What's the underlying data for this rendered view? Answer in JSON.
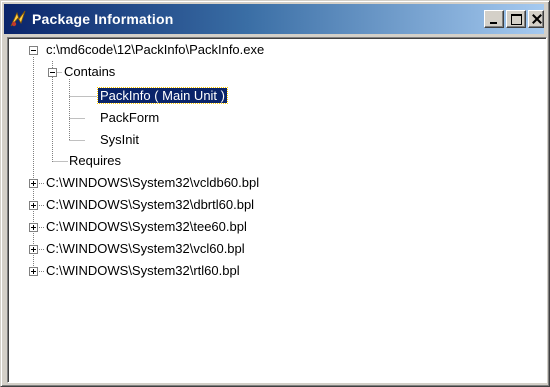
{
  "window": {
    "title": "Package Information",
    "icon": "delphi-package-icon"
  },
  "titlebar_buttons": [
    "minimize-icon",
    "maximize-icon",
    "close-icon"
  ],
  "tree": {
    "root": {
      "label": "c:\\md6code\\12\\PackInfo\\PackInfo.exe",
      "expanded": true
    },
    "contains": {
      "label": "Contains",
      "expanded": true,
      "items": [
        "PackInfo ( Main Unit )",
        "PackForm",
        "SysInit"
      ],
      "selected_index": 0
    },
    "requires": {
      "label": "Requires"
    },
    "packages": [
      "C:\\WINDOWS\\System32\\vcldb60.bpl",
      "C:\\WINDOWS\\System32\\dbrtl60.bpl",
      "C:\\WINDOWS\\System32\\tee60.bpl",
      "C:\\WINDOWS\\System32\\vcl60.bpl",
      "C:\\WINDOWS\\System32\\rtl60.bpl"
    ]
  },
  "colors": {
    "titlebar_start": "#0a246a",
    "titlebar_end": "#a6caf0",
    "selection": "#0a246a"
  }
}
